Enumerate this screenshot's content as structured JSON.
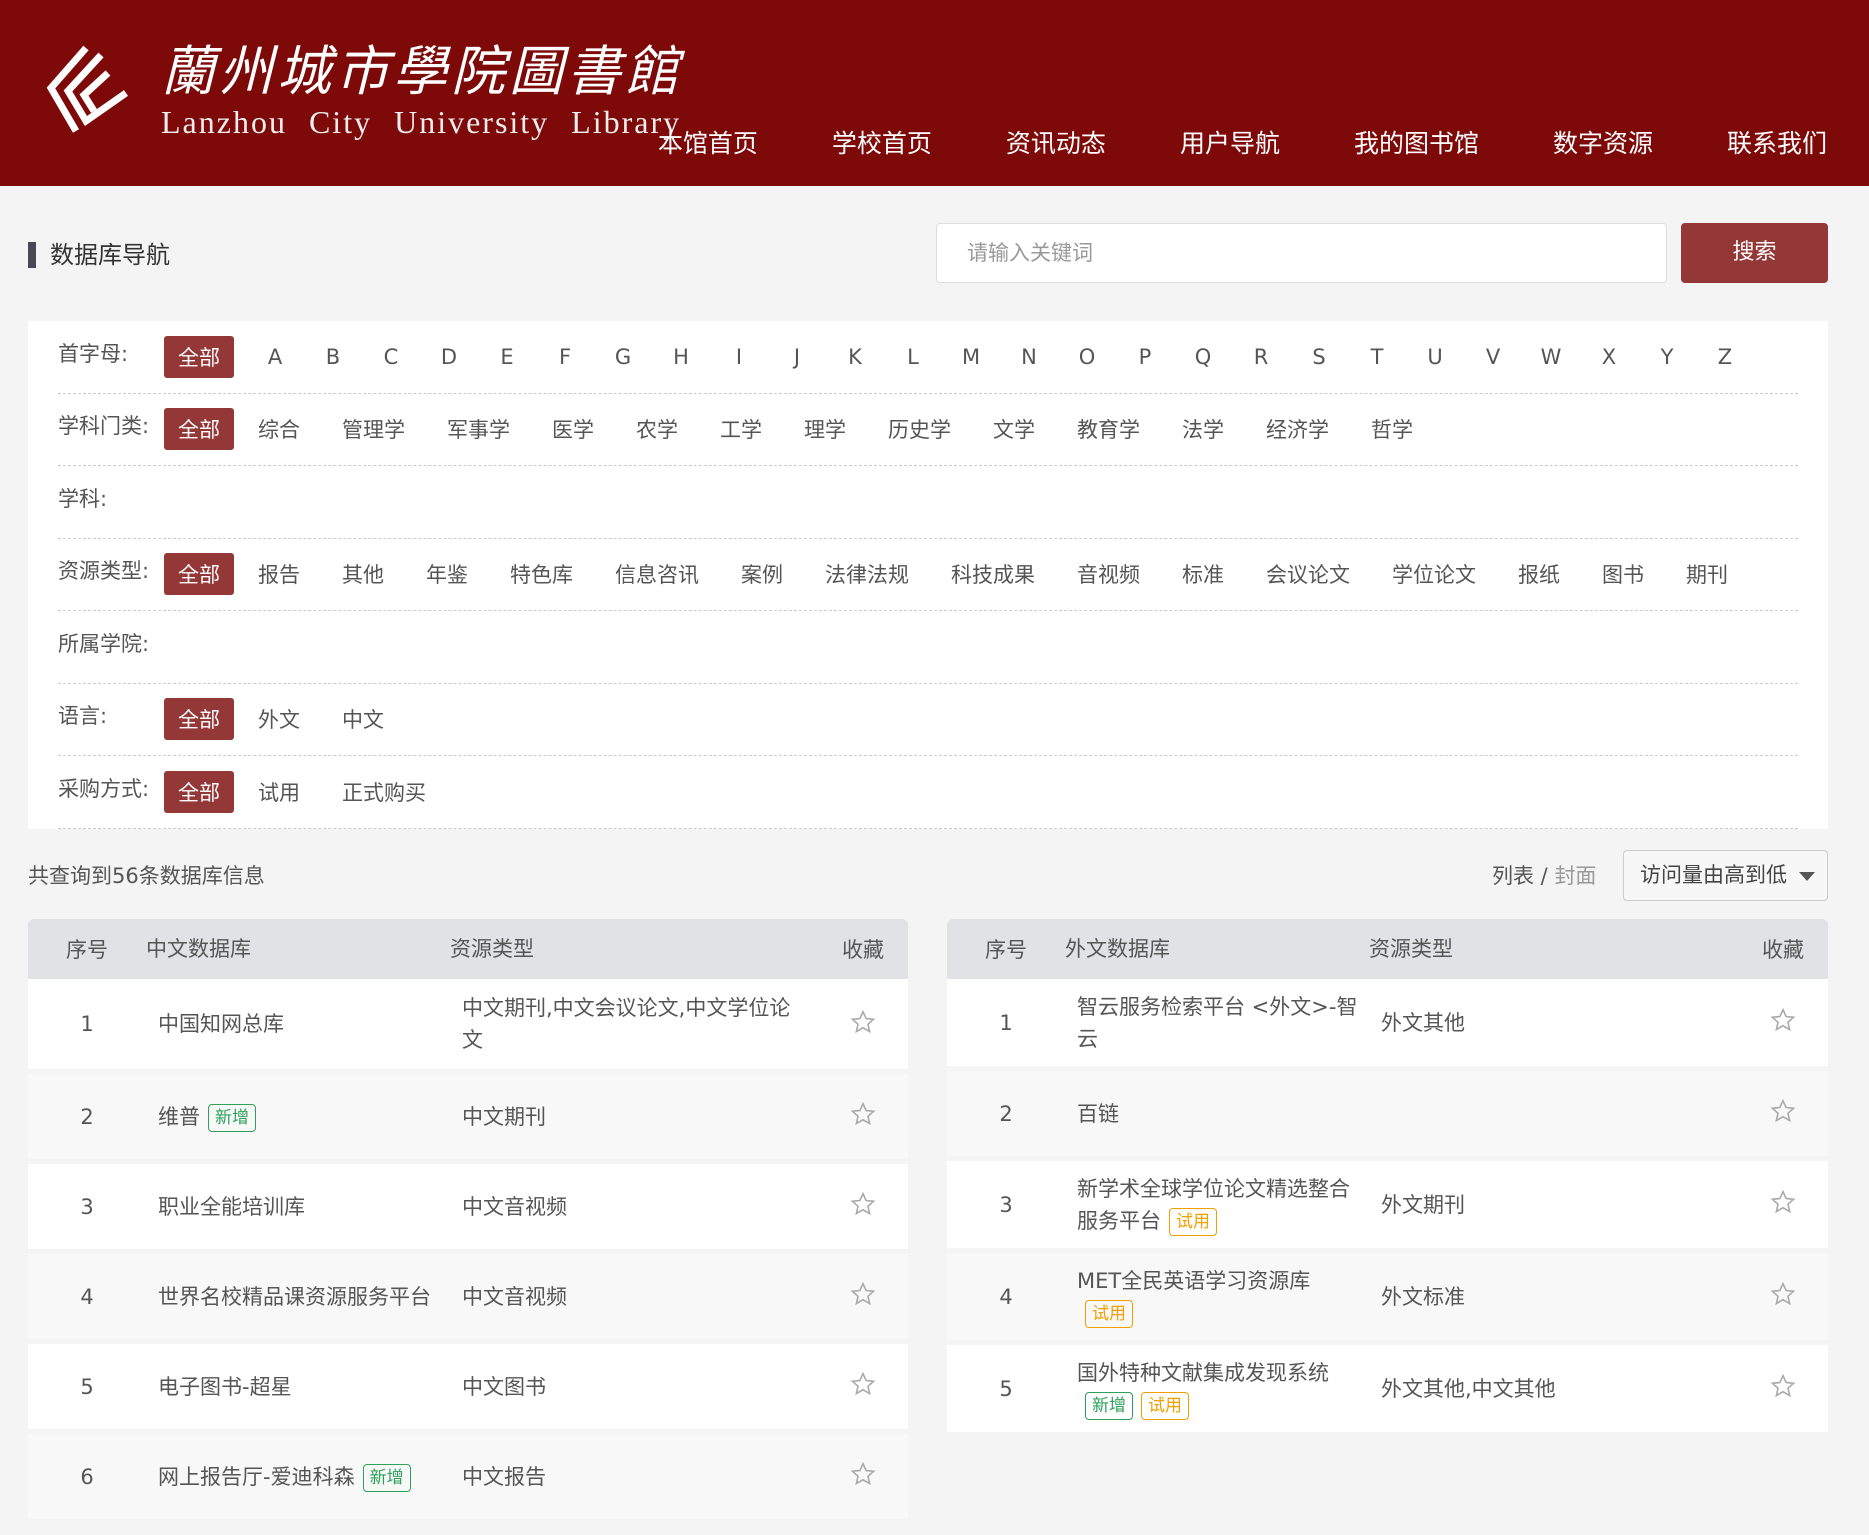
{
  "header": {
    "logo_cn": "蘭州城市學院圖書館",
    "logo_en": "Lanzhou City University Library",
    "nav": [
      "本馆首页",
      "学校首页",
      "资讯动态",
      "用户导航",
      "我的图书馆",
      "数字资源",
      "联系我们"
    ]
  },
  "page_title": "数据库导航",
  "search": {
    "placeholder": "请输入关键词",
    "button": "搜索"
  },
  "filters": {
    "letter": {
      "label": "首字母:",
      "options": [
        "全部",
        "A",
        "B",
        "C",
        "D",
        "E",
        "F",
        "G",
        "H",
        "I",
        "J",
        "K",
        "L",
        "M",
        "N",
        "O",
        "P",
        "Q",
        "R",
        "S",
        "T",
        "U",
        "V",
        "W",
        "X",
        "Y",
        "Z"
      ]
    },
    "category": {
      "label": "学科门类:",
      "options": [
        "全部",
        "综合",
        "管理学",
        "军事学",
        "医学",
        "农学",
        "工学",
        "理学",
        "历史学",
        "文学",
        "教育学",
        "法学",
        "经济学",
        "哲学"
      ]
    },
    "subject": {
      "label": "学科:",
      "options": []
    },
    "resource_type": {
      "label": "资源类型:",
      "options": [
        "全部",
        "报告",
        "其他",
        "年鉴",
        "特色库",
        "信息咨讯",
        "案例",
        "法律法规",
        "科技成果",
        "音视频",
        "标准",
        "会议论文",
        "学位论文",
        "报纸",
        "图书",
        "期刊"
      ]
    },
    "college": {
      "label": "所属学院:",
      "options": []
    },
    "language": {
      "label": "语言:",
      "options": [
        "全部",
        "外文",
        "中文"
      ]
    },
    "purchase": {
      "label": "采购方式:",
      "options": [
        "全部",
        "试用",
        "正式购买"
      ]
    }
  },
  "results": {
    "count_text": "共查询到56条数据库信息",
    "view_list": "列表",
    "view_sep": " / ",
    "view_cover": "封面",
    "sort": "访问量由高到低"
  },
  "tag_labels": {
    "new": "新增",
    "trial": "试用"
  },
  "cn_table": {
    "headers": [
      "序号",
      "中文数据库",
      "资源类型",
      "收藏"
    ],
    "rows": [
      {
        "no": "1",
        "name": "中国知网总库",
        "type": "中文期刊,中文会议论文,中文学位论文",
        "tags": []
      },
      {
        "no": "2",
        "name": "维普",
        "type": "中文期刊",
        "tags": [
          "new"
        ]
      },
      {
        "no": "3",
        "name": "职业全能培训库",
        "type": "中文音视频",
        "tags": []
      },
      {
        "no": "4",
        "name": "世界名校精品课资源服务平台",
        "type": "中文音视频",
        "tags": []
      },
      {
        "no": "5",
        "name": "电子图书-超星",
        "type": "中文图书",
        "tags": []
      },
      {
        "no": "6",
        "name": "网上报告厅-爱迪科森",
        "type": "中文报告",
        "tags": [
          "new"
        ]
      }
    ]
  },
  "foreign_table": {
    "headers": [
      "序号",
      "外文数据库",
      "资源类型",
      "收藏"
    ],
    "rows": [
      {
        "no": "1",
        "name": "智云服务检索平台 <外文>-智云",
        "type": "外文其他",
        "tags": []
      },
      {
        "no": "2",
        "name": "百链",
        "type": "",
        "tags": []
      },
      {
        "no": "3",
        "name": "新学术全球学位论文精选整合服务平台",
        "type": "外文期刊",
        "tags": [
          "trial"
        ]
      },
      {
        "no": "4",
        "name": "MET全民英语学习资源库",
        "type": "外文标准",
        "tags": [
          "trial"
        ]
      },
      {
        "no": "5",
        "name": "国外特种文献集成发现系统",
        "type": "外文其他,中文其他",
        "tags": [
          "new",
          "trial"
        ]
      }
    ]
  },
  "colors": {
    "header": "#7e0909",
    "accent": "#943737",
    "new": "#2ea05a",
    "trial": "#f0a000"
  }
}
